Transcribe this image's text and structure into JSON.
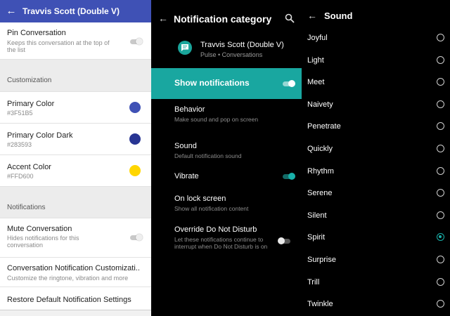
{
  "left": {
    "header": {
      "title": "Travvis Scott (Double V)"
    },
    "pin": {
      "title": "Pin Conversation",
      "subtitle": "Keeps this conversation at the top of the list"
    },
    "customization": {
      "section": "Customization",
      "primary": {
        "title": "Primary Color",
        "value": "#3F51B5",
        "color": "#3F51B5"
      },
      "primary_dark": {
        "title": "Primary Color Dark",
        "value": "#283593",
        "color": "#283593"
      },
      "accent": {
        "title": "Accent Color",
        "value": "#FFD600",
        "color": "#FFD600"
      }
    },
    "notifications": {
      "section": "Notifications",
      "mute": {
        "title": "Mute Conversation",
        "subtitle": "Hides notifications for this conversation"
      },
      "custom": {
        "title": "Conversation Notification Customizati..",
        "subtitle": "Customize the ringtone, vibration and more"
      },
      "restore": {
        "title": "Restore Default Notification Settings"
      }
    }
  },
  "middle": {
    "header": {
      "title": "Notification category"
    },
    "app": {
      "name": "Travvis Scott (Double V)",
      "subtitle": "Pulse • Conversations"
    },
    "show": {
      "label": "Show notifications",
      "on": true
    },
    "behavior": {
      "title": "Behavior",
      "subtitle": "Make sound and pop on screen"
    },
    "sound": {
      "title": "Sound",
      "subtitle": "Default notification sound"
    },
    "vibrate": {
      "title": "Vibrate",
      "on": true
    },
    "lock": {
      "title": "On lock screen",
      "subtitle": "Show all notification content"
    },
    "dnd": {
      "title": "Override Do Not Disturb",
      "subtitle": "Let these notifications continue to interrupt when Do Not Disturb is on",
      "on": false
    }
  },
  "right": {
    "header": {
      "title": "Sound"
    },
    "sounds": [
      "Joyful",
      "Light",
      "Meet",
      "Naivety",
      "Penetrate",
      "Quickly",
      "Rhythm",
      "Serene",
      "Silent",
      "Spirit",
      "Surprise",
      "Trill",
      "Twinkle"
    ],
    "selected": "Spirit"
  }
}
